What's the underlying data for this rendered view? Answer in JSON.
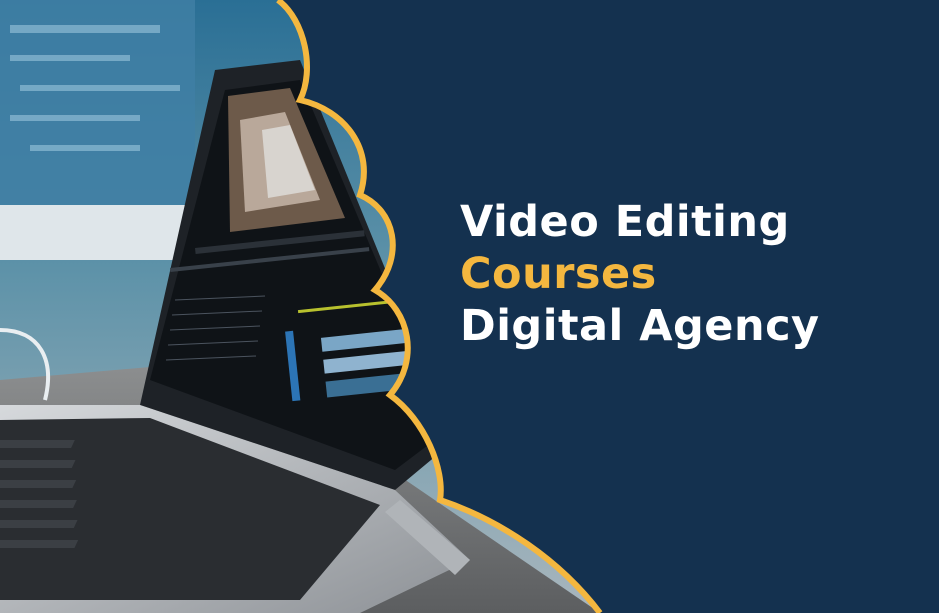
{
  "banner": {
    "headline": {
      "line1": "Video Editing",
      "line2": "Courses",
      "line3": "Digital Agency"
    },
    "colors": {
      "background": "#14314f",
      "accent": "#f4b73f",
      "text": "#ffffff"
    },
    "photo": {
      "description_icon": "laptop-video-editor-photo"
    }
  }
}
